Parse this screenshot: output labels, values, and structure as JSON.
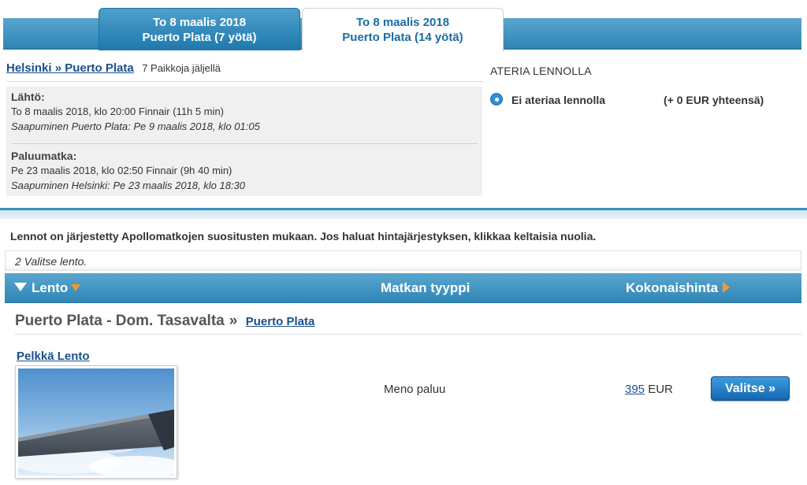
{
  "tabs": [
    {
      "line1": "To 8 maalis 2018",
      "line2": "Puerto Plata (7 yötä)",
      "active": false
    },
    {
      "line1": "To 8 maalis 2018",
      "line2": "Puerto Plata (14 yötä)",
      "active": true
    }
  ],
  "route": {
    "link": "Helsinki » Puerto Plata",
    "seats": "7 Paikkoja jäljellä"
  },
  "meal": {
    "title": "ATERIA LENNOLLA",
    "option_label": "Ei ateriaa lennolla",
    "option_price": "(+ 0 EUR yhteensä)",
    "selected": true
  },
  "outbound": {
    "title": "Lähtö:",
    "line": "To 8 maalis 2018, klo 20:00 Finnair (11h 5 min)",
    "arrival": "Saapuminen Puerto Plata: Pe 9 maalis 2018, klo 01:05"
  },
  "return": {
    "title": "Paluumatka:",
    "line": "Pe 23 maalis 2018, klo 02:50 Finnair (9h 40 min)",
    "arrival": "Saapuminen Helsinki: Pe 23 maalis 2018, klo 18:30"
  },
  "sort_note": "Lennot on järjestetty Apollomatkojen suositusten mukaan. Jos haluat hintajärjestyksen, klikkaa keltaisia nuolia.",
  "step": "2 Valitse lento.",
  "table_header": {
    "flight": "Lento",
    "trip_type": "Matkan tyyppi",
    "total_price": "Kokonaishinta"
  },
  "destination": {
    "name": "Puerto Plata - Dom. Tasavalta",
    "separator": "»",
    "link": "Puerto Plata"
  },
  "product": {
    "link": "Pelkkä Lento",
    "image_icon": "airplane-wing-photo",
    "trip_type": "Meno paluu",
    "price_value": "395",
    "currency": "EUR",
    "button": "Valitse »"
  },
  "colors": {
    "accent_blue": "#2f86b6",
    "link_blue": "#1a4f8b",
    "sort_arrow": "#f29a2e"
  }
}
